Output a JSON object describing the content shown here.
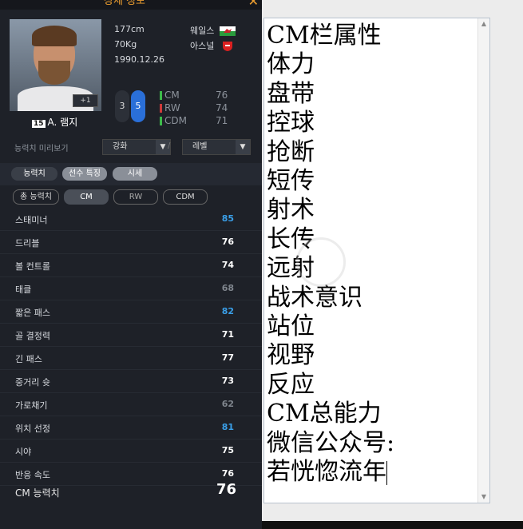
{
  "window": {
    "title": "상세 정보"
  },
  "player": {
    "height": "177cm",
    "weight": "70Kg",
    "birth": "1990.12.26",
    "nation": "웨일스",
    "club": "아스널",
    "number": "15",
    "name": "A. 램지",
    "level": "+1",
    "weak_foot": "3",
    "strong_foot": "5"
  },
  "positions": [
    {
      "pos": "CM",
      "ovr": "76",
      "color": "#3dbb4a"
    },
    {
      "pos": "RW",
      "ovr": "74",
      "color": "#d03a3a"
    },
    {
      "pos": "CDM",
      "ovr": "71",
      "color": "#3dbb4a"
    }
  ],
  "preview": {
    "label": "능력치 미리보기",
    "enhance": "강화",
    "level": "레벨",
    "sep": "/"
  },
  "tabs": [
    "능력치",
    "선수 특징",
    "시세"
  ],
  "subtabs": [
    "총 능력치",
    "CM",
    "RW",
    "CDM"
  ],
  "stats": [
    {
      "label": "스태미너",
      "value": "85",
      "color": "#3a9fe8"
    },
    {
      "label": "드리블",
      "value": "76",
      "color": "#ffffff"
    },
    {
      "label": "볼 컨트롤",
      "value": "74",
      "color": "#ffffff"
    },
    {
      "label": "태클",
      "value": "68",
      "color": "#7f858d"
    },
    {
      "label": "짧은 패스",
      "value": "82",
      "color": "#3a9fe8"
    },
    {
      "label": "골 결정력",
      "value": "71",
      "color": "#ffffff"
    },
    {
      "label": "긴 패스",
      "value": "77",
      "color": "#ffffff"
    },
    {
      "label": "중거리 슛",
      "value": "73",
      "color": "#ffffff"
    },
    {
      "label": "가로채기",
      "value": "62",
      "color": "#7f858d"
    },
    {
      "label": "위치 선정",
      "value": "81",
      "color": "#3a9fe8"
    },
    {
      "label": "시야",
      "value": "75",
      "color": "#ffffff"
    },
    {
      "label": "반응 속도",
      "value": "76",
      "color": "#ffffff"
    }
  ],
  "total": {
    "label": "CM 능력치",
    "value": "76"
  },
  "editor": {
    "lines": [
      "CM栏属性",
      "体力",
      "盘带",
      "控球",
      "抢断",
      "短传",
      "射术",
      "长传",
      "远射",
      "战术意识",
      "站位",
      "视野",
      "反应",
      "CM总能力",
      "微信公众号:",
      "若恍惚流年"
    ]
  }
}
